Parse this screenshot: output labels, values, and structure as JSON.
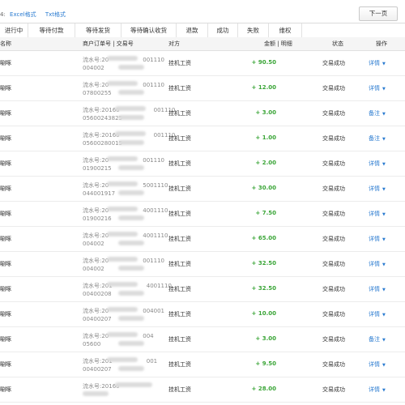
{
  "export": {
    "prefix": "4:",
    "excel": "Excel格式",
    "txt": "Txt格式"
  },
  "pager": {
    "next_label": "下一页"
  },
  "tabs": [
    "进行中",
    "等待付款",
    "等待发货",
    "等待确认收货",
    "退款",
    "成功",
    "失败",
    "维权"
  ],
  "table": {
    "headers": {
      "name": "名称",
      "order": "商户订单号 | 交易号",
      "party": "对方",
      "amount": "金额 | 明细",
      "status": "状态",
      "op": "操作"
    },
    "rows": [
      {
        "name": "唰啄",
        "order1": "流水号:20",
        "order1_tail": "001110",
        "order2": "004002",
        "party": "挂机工资",
        "amount": "+ 90.50",
        "status": "交易成功",
        "op": "详情"
      },
      {
        "name": "唰啄",
        "order1": "流水号:20",
        "order1_tail": "001110",
        "order2": "07800255",
        "party": "挂机工资",
        "amount": "+ 12.00",
        "status": "交易成功",
        "op": "详情"
      },
      {
        "name": "唰啄",
        "order1": "流水号:20160",
        "order1_tail": "001110",
        "order2": "05600243825",
        "party": "挂机工资",
        "amount": "+ 3.00",
        "status": "交易成功",
        "op": "备注"
      },
      {
        "name": "唰啄",
        "order1": "流水号:20160",
        "order1_tail": "001110",
        "order2": "05600280015",
        "party": "挂机工资",
        "amount": "+ 1.00",
        "status": "交易成功",
        "op": "备注"
      },
      {
        "name": "唰啄",
        "order1": "流水号:20",
        "order1_tail": "001110",
        "order2": "01900215",
        "party": "挂机工资",
        "amount": "+ 2.00",
        "status": "交易成功",
        "op": "详情"
      },
      {
        "name": "唰啄",
        "order1": "流水号:20",
        "order1_tail": "5001110",
        "order2": "044001917",
        "party": "挂机工资",
        "amount": "+ 30.00",
        "status": "交易成功",
        "op": "详情"
      },
      {
        "name": "唰啄",
        "order1": "流水号:20",
        "order1_tail": "4001110",
        "order2": "01900216",
        "party": "挂机工资",
        "amount": "+ 7.50",
        "status": "交易成功",
        "op": "详情"
      },
      {
        "name": "唰啄",
        "order1": "流水号:20",
        "order1_tail": "4001110",
        "order2": "004002",
        "party": "挂机工资",
        "amount": "+ 65.00",
        "status": "交易成功",
        "op": "详情"
      },
      {
        "name": "唰啄",
        "order1": "流水号:20",
        "order1_tail": "001110",
        "order2": "004002",
        "party": "挂机工资",
        "amount": "+ 32.50",
        "status": "交易成功",
        "op": "详情"
      },
      {
        "name": "唰啄",
        "order1": "流水号:201",
        "order1_tail": "4001110",
        "order2": "00400208",
        "party": "挂机工资",
        "amount": "+ 32.50",
        "status": "交易成功",
        "op": "详情"
      },
      {
        "name": "唰啄",
        "order1": "流水号:20",
        "order1_tail": "004001",
        "order2": "00400207",
        "party": "挂机工资",
        "amount": "+ 10.00",
        "status": "交易成功",
        "op": "详情"
      },
      {
        "name": "唰啄",
        "order1": "流水号:20",
        "order1_tail": "004",
        "order2": "05600",
        "party": "挂机工资",
        "amount": "+ 3.00",
        "status": "交易成功",
        "op": "备注"
      },
      {
        "name": "唰啄",
        "order1": "流水号:201",
        "order1_tail": "001",
        "order2": "00400207",
        "party": "挂机工资",
        "amount": "+ 9.50",
        "status": "交易成功",
        "op": "详情"
      },
      {
        "name": "唰啄",
        "order1": "流水号:20160",
        "order1_tail": "",
        "order2": "",
        "party": "挂机工资",
        "amount": "+ 28.00",
        "status": "交易成功",
        "op": "详情"
      }
    ]
  },
  "colors": {
    "amount": "#3aa537",
    "link": "#2a7bd0",
    "header_bg": "#f5f5f5"
  },
  "icons": {
    "op_caret": "caret-down-icon"
  }
}
